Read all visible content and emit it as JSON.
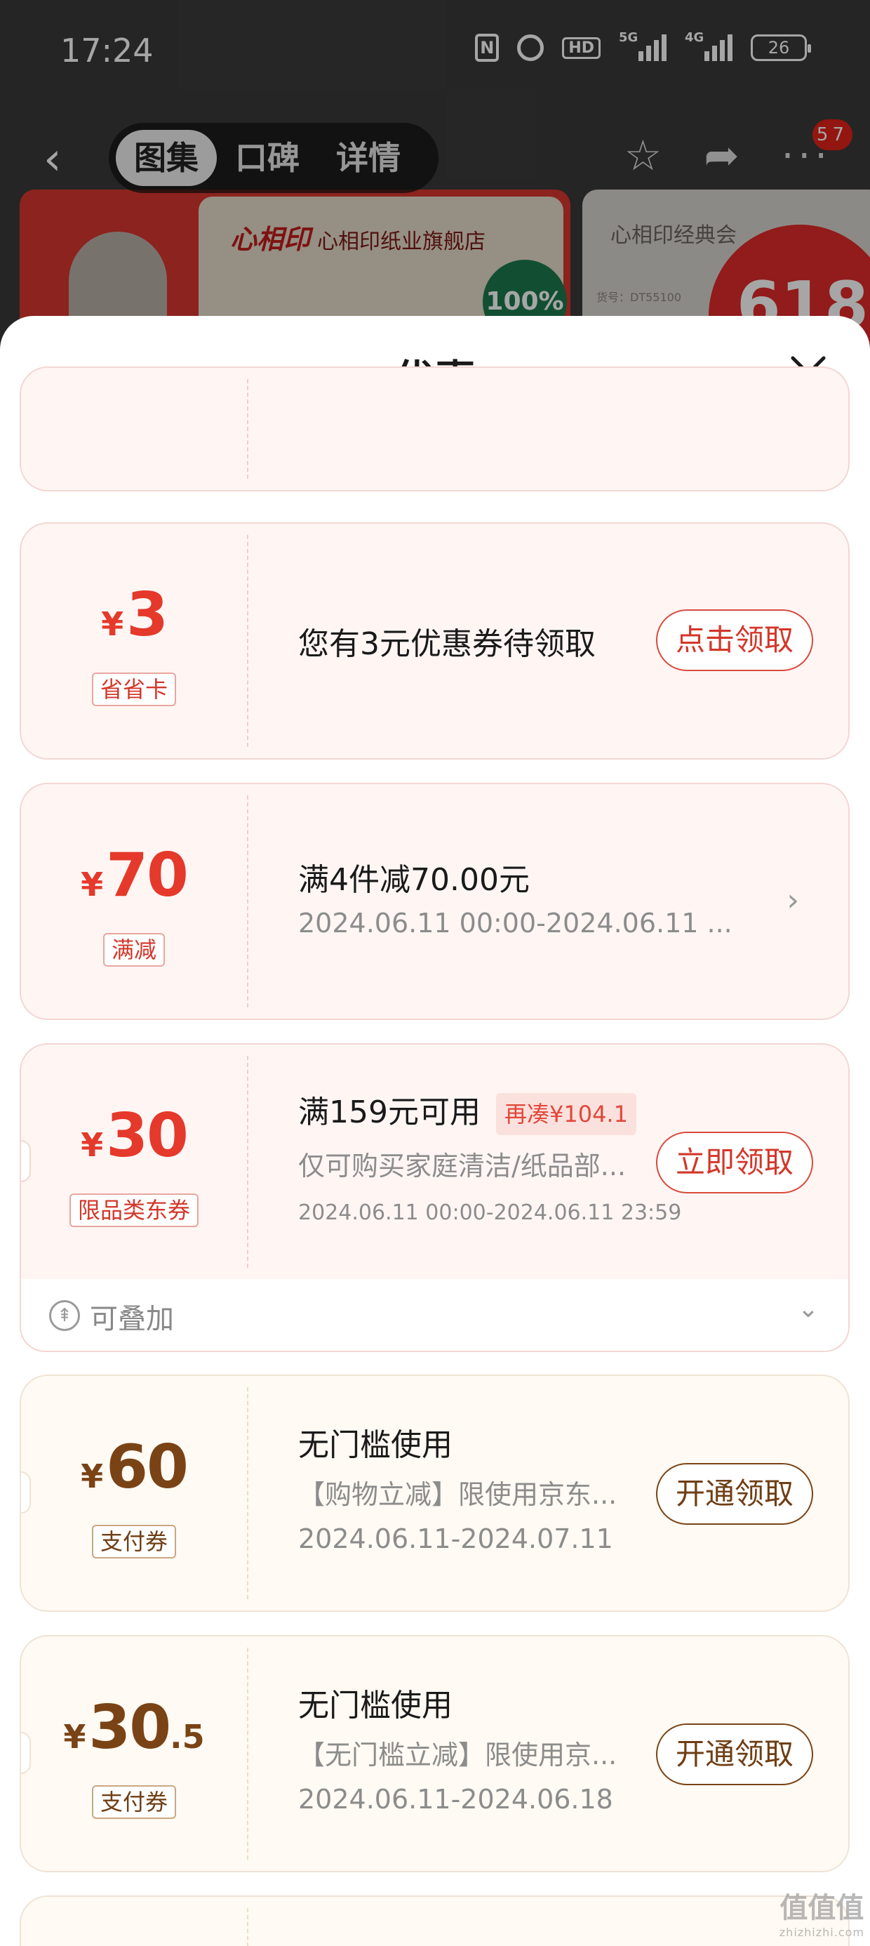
{
  "status_bar": {
    "time": "17:24",
    "hd_label": "HD",
    "net1": "5G",
    "net2": "4G",
    "battery": "26"
  },
  "nav": {
    "tabs": [
      "图集",
      "口碑",
      "详情"
    ],
    "active_tab": 0,
    "more_badge": "57"
  },
  "background": {
    "store_brand": "心相印",
    "store_name": "心相印纸业旗舰店",
    "seal_text": "100%",
    "product_title": "心相印经典会",
    "sku": "货号：DT55100",
    "promo_badge": "618"
  },
  "sheet": {
    "title": "优惠"
  },
  "coupons": [
    {
      "currency": "¥",
      "amount": "3",
      "tag": "省省卡",
      "title": "您有3元优惠券待领取",
      "action": "点击领取",
      "style": "red"
    },
    {
      "currency": "¥",
      "amount": "70",
      "tag": "满减",
      "title": "满4件减70.00元",
      "subtitle": "2024.06.11 00:00-2024.06.11 ...",
      "style": "red"
    },
    {
      "currency": "¥",
      "amount": "30",
      "tag": "限品类东券",
      "title": "满159元可用",
      "extra_tag": "再凑¥104.1",
      "subtitle": "仅可购买家庭清洁/纸品部...",
      "validity": "2024.06.11 00:00-2024.06.11 23:59",
      "action": "立即领取",
      "stackable": "可叠加",
      "style": "red"
    },
    {
      "currency": "¥",
      "amount": "60",
      "tag": "支付券",
      "title": "无门槛使用",
      "subtitle": "【购物立减】限使用京东...",
      "validity": "2024.06.11-2024.07.11",
      "action": "开通领取",
      "style": "gold"
    },
    {
      "currency": "¥",
      "amount": "30",
      "amount_decimal": ".5",
      "tag": "支付券",
      "title": "无门槛使用",
      "subtitle": "【无门槛立减】限使用京...",
      "validity": "2024.06.11-2024.06.18",
      "action": "开通领取",
      "style": "gold"
    }
  ],
  "watermark": {
    "main": "值值值",
    "sub": "zhizhizhi.com"
  }
}
